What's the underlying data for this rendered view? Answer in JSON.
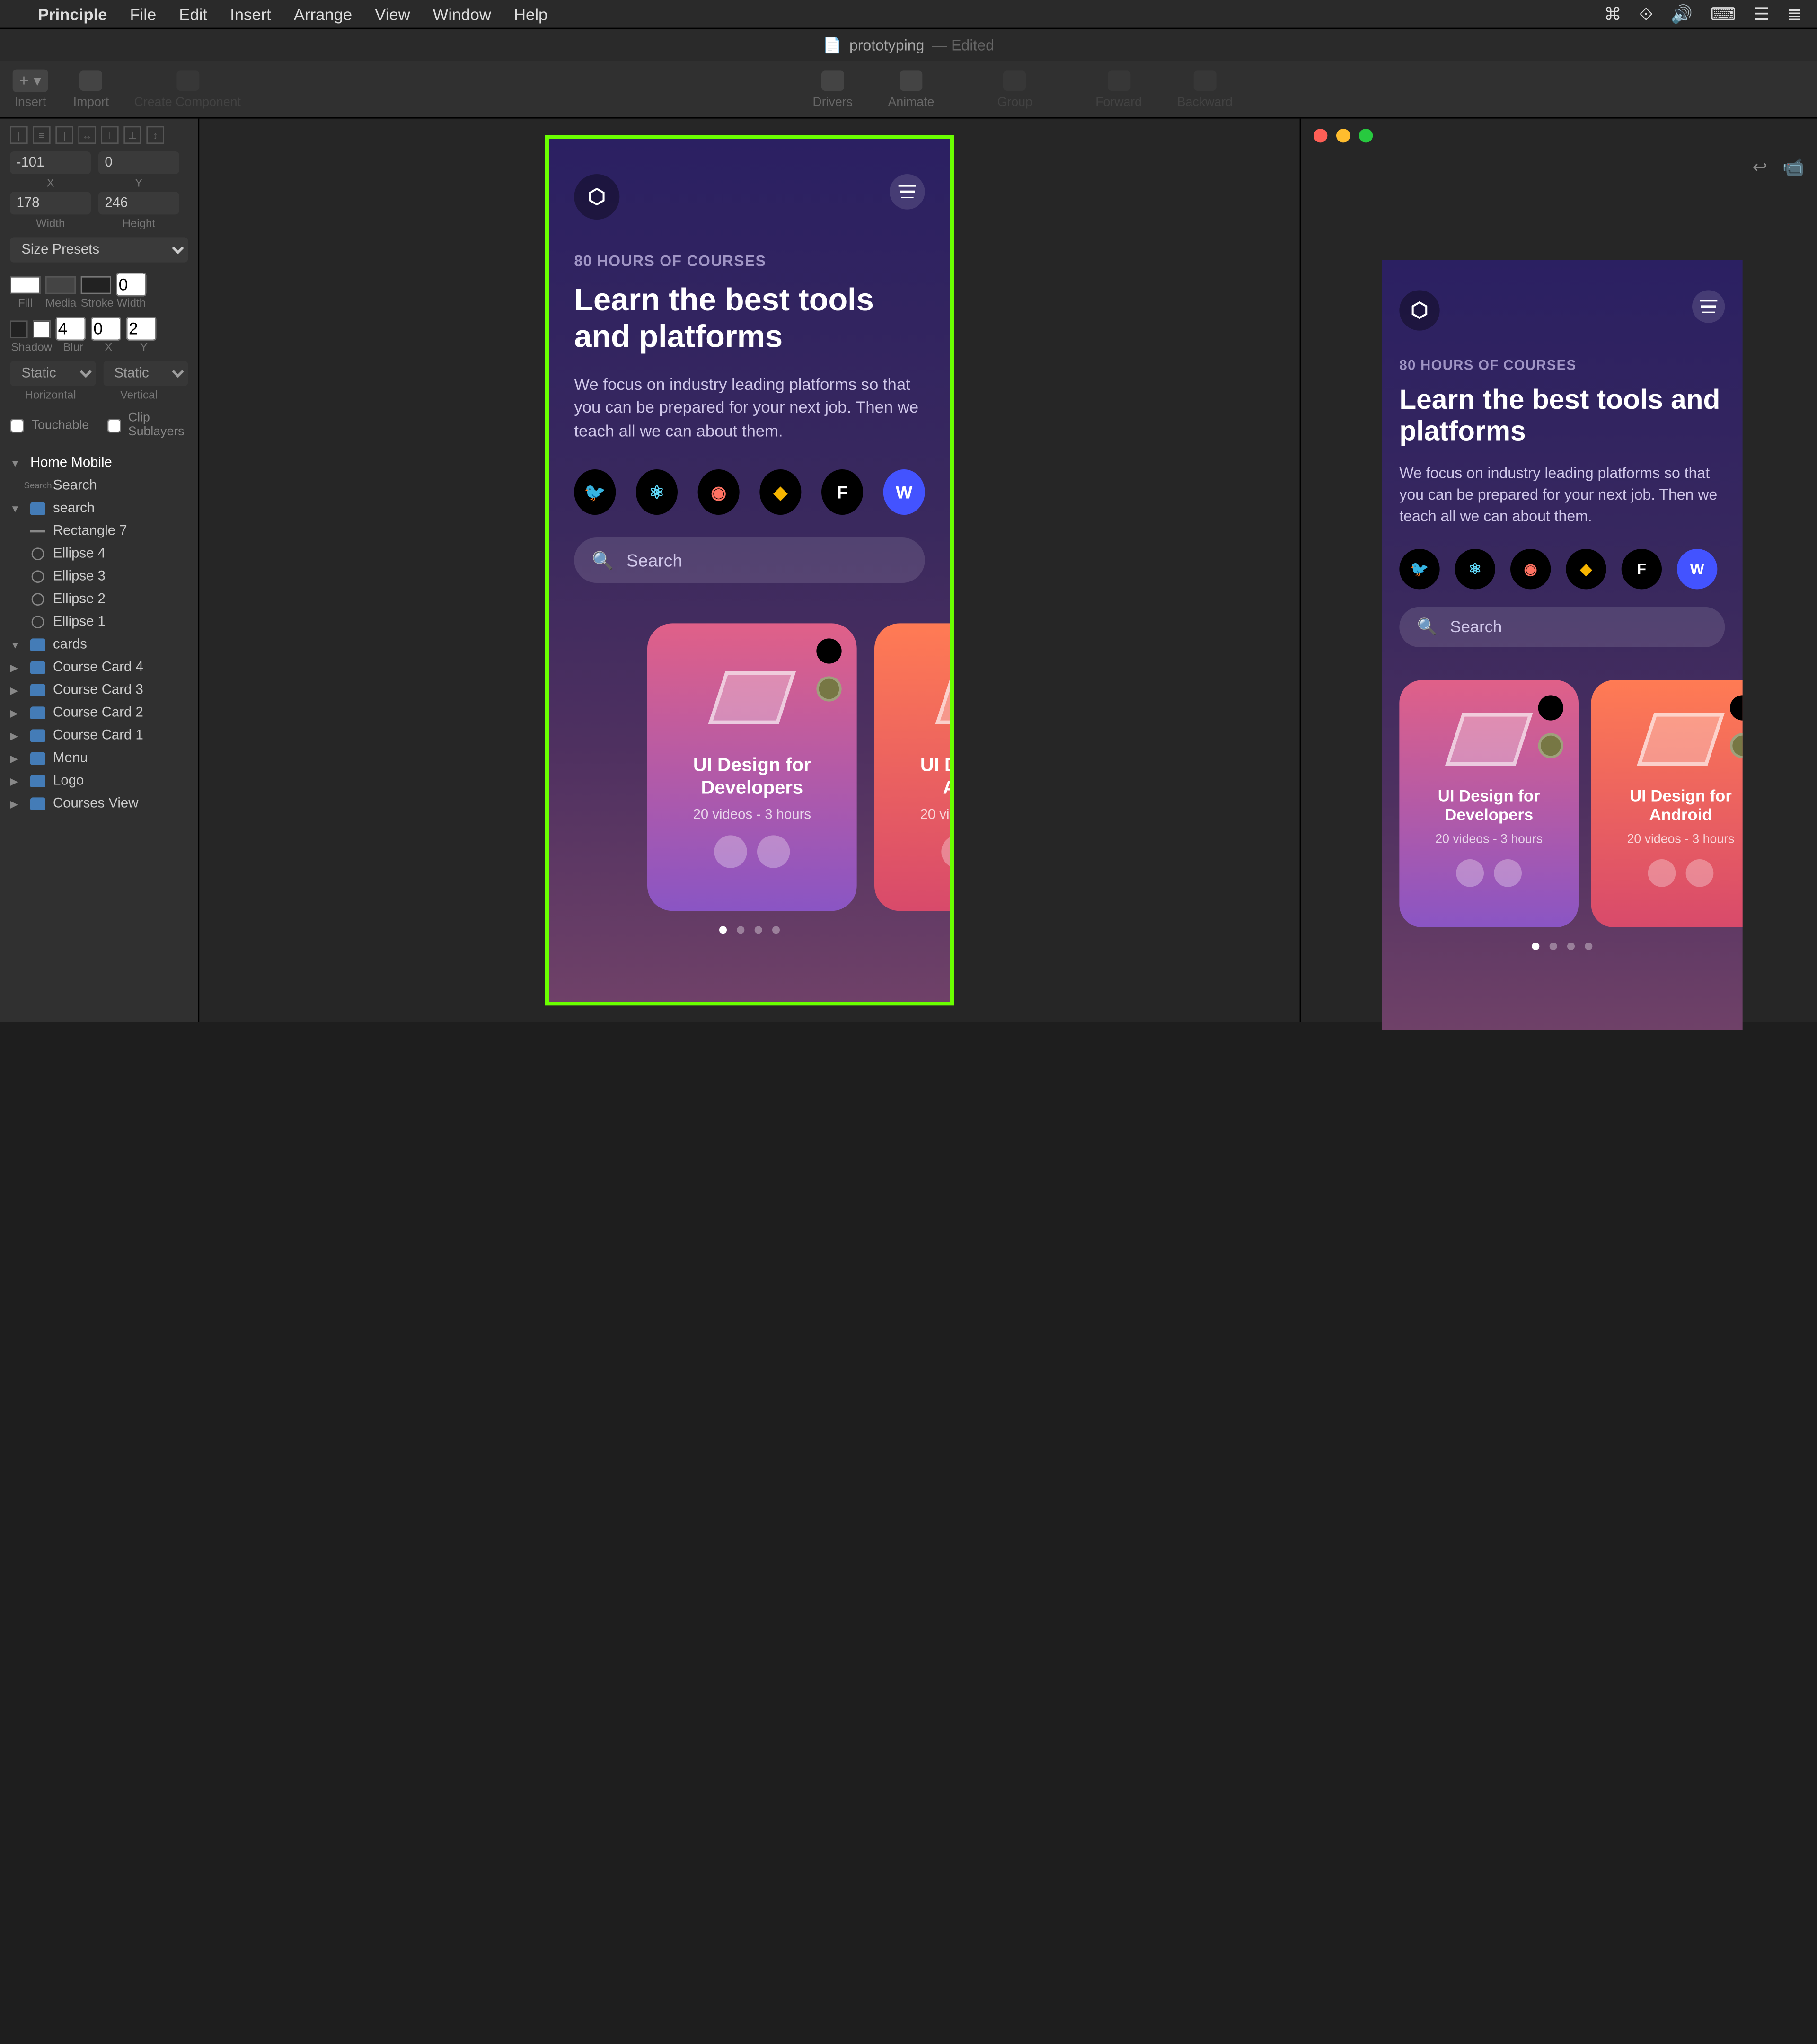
{
  "menu": {
    "apple": "",
    "app": "Principle",
    "items": [
      "File",
      "Edit",
      "Insert",
      "Arrange",
      "View",
      "Window",
      "Help"
    ],
    "status": [
      "⌘",
      "⟐",
      "🔊",
      "⌨",
      "☰",
      "≣"
    ]
  },
  "doc": {
    "icon": "📄",
    "name": "prototyping",
    "state": "— Edited"
  },
  "toolbar": {
    "insert": "Insert",
    "import": "Import",
    "create_component": "Create Component",
    "drivers": "Drivers",
    "animate": "Animate",
    "group": "Group",
    "forward": "Forward",
    "backward": "Backward"
  },
  "inspector": {
    "x": "-101",
    "y": "0",
    "width": "178",
    "height": "246",
    "xL": "X",
    "yL": "Y",
    "wL": "Width",
    "hL": "Height",
    "size_presets": "Size Presets",
    "fill": "Fill",
    "media": "Media",
    "stroke": "Stroke",
    "widthS": "Width",
    "strokeVal": "0",
    "shadow": "Shadow",
    "blur": "Blur",
    "sx": "X",
    "sy": "Y",
    "blurVal": "4",
    "yVal": "0",
    "y2Val": "2",
    "h_static": "Static",
    "v_static": "Static",
    "horizontal": "Horizontal",
    "vertical": "Vertical",
    "touchable": "Touchable",
    "clip": "Clip Sublayers"
  },
  "layers": [
    {
      "lvl": 0,
      "type": "artboard",
      "tri": "▼",
      "name": "Home Mobile"
    },
    {
      "lvl": 1,
      "type": "search",
      "tri": "",
      "name": "Search",
      "prefix": "Search"
    },
    {
      "lvl": 1,
      "type": "folder",
      "tri": "▼",
      "name": "search"
    },
    {
      "lvl": 2,
      "type": "rect",
      "tri": "",
      "name": "Rectangle 7"
    },
    {
      "lvl": 2,
      "type": "ellipse",
      "tri": "",
      "name": "Ellipse 4"
    },
    {
      "lvl": 2,
      "type": "ellipse",
      "tri": "",
      "name": "Ellipse 3"
    },
    {
      "lvl": 2,
      "type": "ellipse",
      "tri": "",
      "name": "Ellipse 2"
    },
    {
      "lvl": 2,
      "type": "ellipse",
      "tri": "",
      "name": "Ellipse 1"
    },
    {
      "lvl": 1,
      "type": "folder",
      "tri": "▼",
      "name": "cards"
    },
    {
      "lvl": 2,
      "type": "folder",
      "tri": "▶",
      "name": "Course Card 4"
    },
    {
      "lvl": 2,
      "type": "folder",
      "tri": "▶",
      "name": "Course Card 3"
    },
    {
      "lvl": 2,
      "type": "folder",
      "tri": "▶",
      "name": "Course Card 2"
    },
    {
      "lvl": 2,
      "type": "folder",
      "tri": "▶",
      "name": "Course Card 1"
    },
    {
      "lvl": 1,
      "type": "folder",
      "tri": "▶",
      "name": "Menu"
    },
    {
      "lvl": 1,
      "type": "folder",
      "tri": "▶",
      "name": "Logo"
    },
    {
      "lvl": 1,
      "type": "folder",
      "tri": "▶",
      "name": "Courses View"
    }
  ],
  "mock": {
    "eyebrow": "80 HOURS OF COURSES",
    "title": "Learn the best tools and platforms",
    "desc": "We focus on industry leading platforms so that you can be prepared for your next job. Then we teach all we can about them.",
    "search": "Search",
    "icons": [
      "swift",
      "react",
      "figma",
      "sketch",
      "framer",
      "webflow"
    ],
    "icon_glyphs": {
      "swift": "🐦",
      "react": "⚛",
      "figma": "◉",
      "sketch": "◆",
      "framer": "F",
      "webflow": "W"
    },
    "icon_colors": {
      "swift": "#ff6a3c",
      "react": "#61dafb",
      "figma": "#ff7262",
      "sketch": "#f7b500",
      "framer": "#fff",
      "webflow": "#fff"
    },
    "icon_bg": {
      "swift": "#000",
      "react": "#000",
      "figma": "#000",
      "sketch": "#000",
      "framer": "#000",
      "webflow": "#4353ff"
    },
    "card1": {
      "title": "UI Design for Developers",
      "sub": "20 videos - 3 hours"
    },
    "card2": {
      "title": "UI Design for Android",
      "sub": "20 videos - 3 hours"
    }
  }
}
